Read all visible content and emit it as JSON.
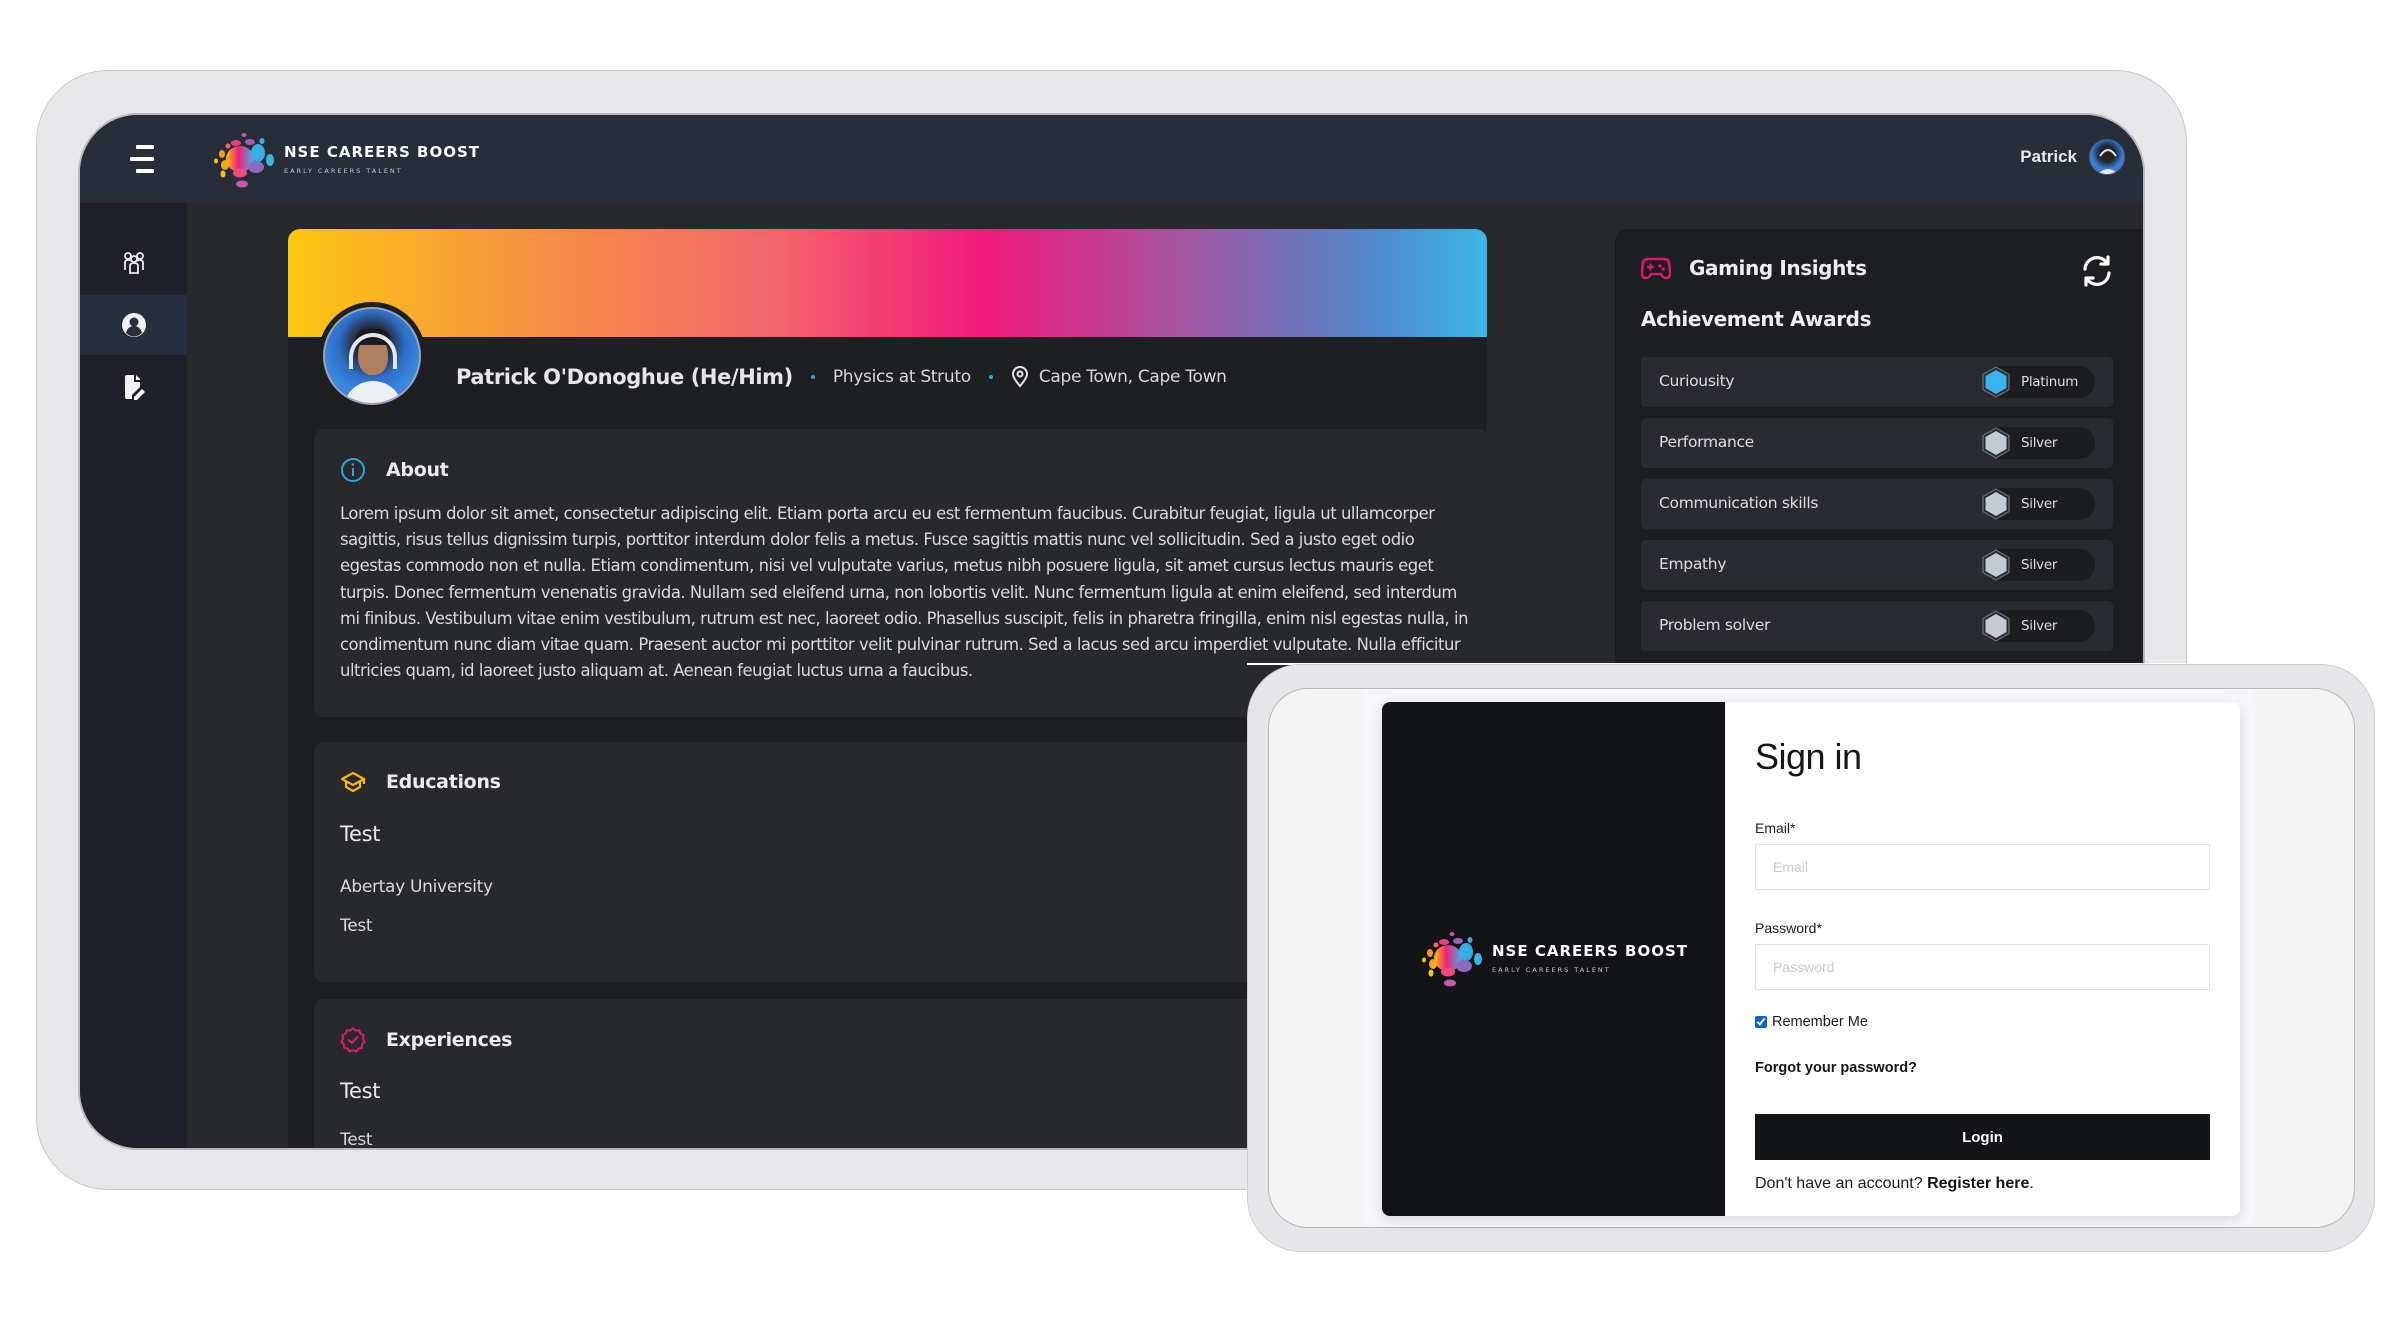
{
  "app": {
    "brand_title": "NSE CAREERS BOOST",
    "brand_subtitle": "EARLY CAREERS TALENT"
  },
  "header": {
    "user_name": "Patrick"
  },
  "sidebar": {
    "items": [
      {
        "name": "community",
        "icon": "users-group-icon",
        "active": false
      },
      {
        "name": "profile",
        "icon": "user-circle-icon",
        "active": true
      },
      {
        "name": "documents",
        "icon": "document-edit-icon",
        "active": false
      }
    ]
  },
  "profile": {
    "name": "Patrick O'Donoghue (He/Him)",
    "role": "Physics at Struto",
    "location": "Cape Town, Cape Town"
  },
  "about": {
    "title": "About",
    "text": "Lorem ipsum dolor sit amet, consectetur adipiscing elit. Etiam porta arcu eu est fermentum faucibus. Curabitur feugiat, ligula ut ullamcorper sagittis, risus tellus dignissim turpis, porttitor interdum dolor felis a metus. Fusce sagittis mattis nunc vel sollicitudin. Sed a justo eget odio egestas commodo non et nulla. Etiam condimentum, nisi vel vulputate varius, metus nibh posuere ligula, sit amet cursus lectus mauris eget turpis. Donec fermentum venenatis gravida. Nullam sed eleifend urna, non lobortis velit. Nunc fermentum ligula at enim eleifend, sed interdum mi finibus. Vestibulum vitae enim vestibulum, rutrum est nec, laoreet odio. Phasellus suscipit, felis in pharetra fringilla, enim nisl egestas nulla, in condimentum nunc diam vitae quam. Praesent auctor mi porttitor velit pulvinar rutrum. Sed a lacus sed arcu imperdiet vulputate. Nulla efficitur ultricies quam, id laoreet justo aliquam at. Aenean feugiat luctus urna a faucibus."
  },
  "educations": {
    "title": "Educations",
    "entries": [
      {
        "title": "Test",
        "institution": "Abertay University",
        "detail": "Test"
      }
    ]
  },
  "experiences": {
    "title": "Experiences",
    "entries": [
      {
        "title": "Test",
        "detail": "Test"
      }
    ]
  },
  "gaming": {
    "title": "Gaming Insights",
    "subtitle": "Achievement Awards",
    "awards": [
      {
        "label": "Curiousity",
        "level": "Platinum",
        "color": "#3ab4ef"
      },
      {
        "label": "Performance",
        "level": "Silver",
        "color": "#c3ccd4"
      },
      {
        "label": "Communication skills",
        "level": "Silver",
        "color": "#c3ccd4"
      },
      {
        "label": "Empathy",
        "level": "Silver",
        "color": "#c3ccd4"
      },
      {
        "label": "Problem solver",
        "level": "Silver",
        "color": "#c3ccd4"
      }
    ]
  },
  "signin": {
    "title": "Sign in",
    "email_label": "Email*",
    "email_placeholder": "Email",
    "email_value": "",
    "password_label": "Password*",
    "password_placeholder": "Password",
    "password_value": "",
    "remember_label": "Remember Me",
    "remember_checked": true,
    "forgot_label": "Forgot your password?",
    "login_label": "Login",
    "register_prompt": "Don't have an account?",
    "register_link": "Register here",
    "register_suffix": "."
  },
  "colors": {
    "accent_pink": "#e5176d",
    "accent_blue": "#33a6d6",
    "accent_yellow": "#f5b80f"
  }
}
